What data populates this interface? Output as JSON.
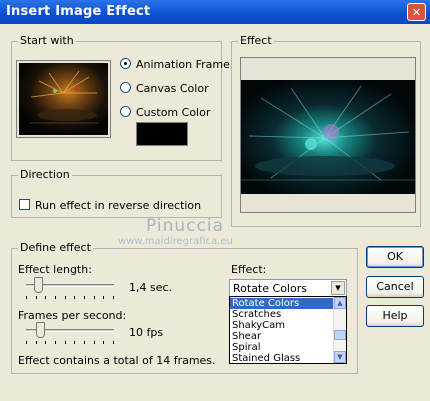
{
  "window": {
    "title": "Insert Image Effect",
    "close_glyph": "✕"
  },
  "start_with": {
    "legend": "Start with",
    "options": [
      "Animation Frame",
      "Canvas Color",
      "Custom Color"
    ],
    "selected": "Animation Frame",
    "custom_color": "#000000"
  },
  "effect_preview": {
    "legend": "Effect"
  },
  "direction": {
    "legend": "Direction",
    "reverse_label": "Run effect in reverse direction",
    "reverse_checked": false
  },
  "watermark": {
    "name": "Pinuccia",
    "site": "www.maidiregrafica.eu"
  },
  "define_effect": {
    "legend": "Define effect",
    "length_label": "Effect length:",
    "length_value": "1,4 sec.",
    "length_fraction": 0.14,
    "fps_label": "Frames per second:",
    "fps_value": "10 fps",
    "fps_fraction": 0.16,
    "total_text": "Effect contains a total of 14 frames.",
    "effect_label": "Effect:",
    "effect_selected": "Rotate Colors",
    "effect_list": [
      "Rotate Colors",
      "Scratches",
      "ShakyCam",
      "Shear",
      "Spiral",
      "Stained Glass"
    ],
    "effect_list_selected_index": 0
  },
  "buttons": {
    "ok": "OK",
    "cancel": "Cancel",
    "help": "Help"
  }
}
